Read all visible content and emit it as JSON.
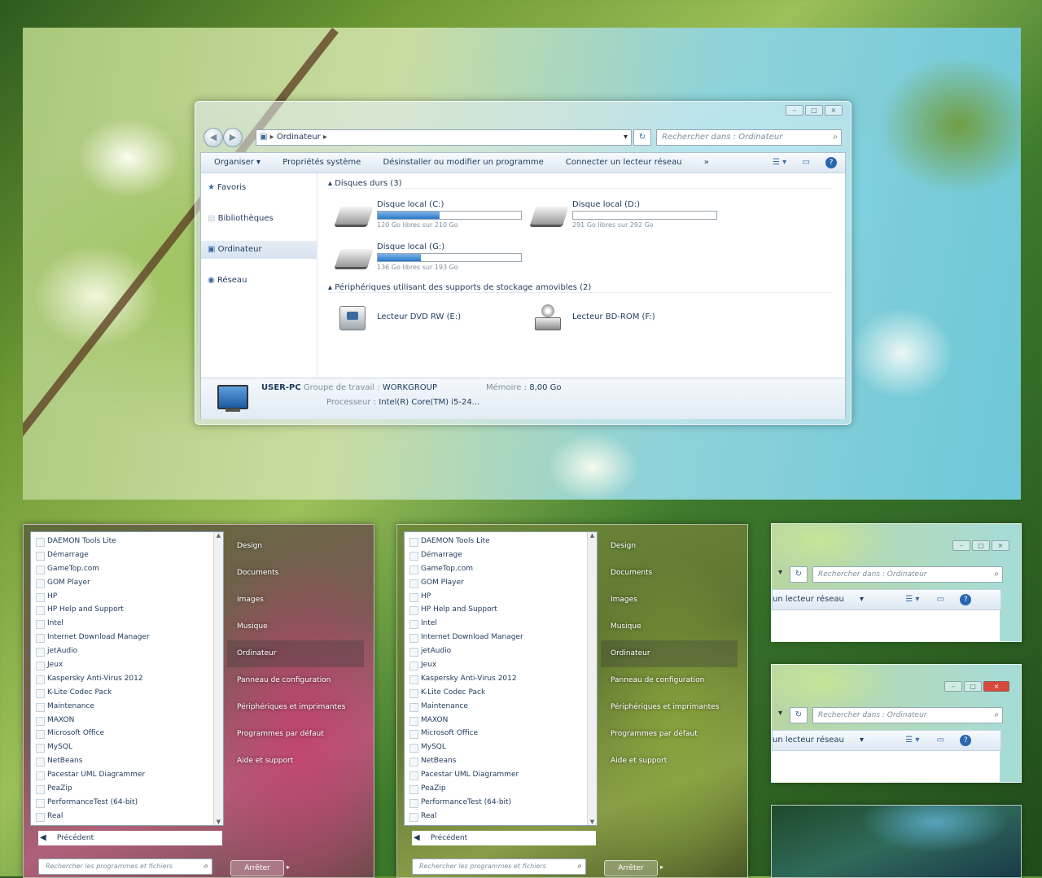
{
  "explorer": {
    "breadcrumb": "Ordinateur",
    "search_placeholder": "Rechercher dans : Ordinateur",
    "toolbar": [
      "Organiser ▾",
      "Propriétés système",
      "Désinstaller ou modifier un programme",
      "Connecter un lecteur réseau",
      "»"
    ],
    "nav": [
      "Favoris",
      "Bibliothèques",
      "Ordinateur",
      "Réseau"
    ],
    "hard_drives_header": "Disques durs (3)",
    "drives": [
      {
        "name": "Disque local (C:)",
        "free": "120 Go libres sur 210 Go",
        "used_fraction": 0.43
      },
      {
        "name": "Disque local (D:)",
        "free": "291 Go libres sur 292 Go",
        "used_fraction": 0.0
      },
      {
        "name": "Disque local (G:)",
        "free": "136 Go libres sur 193 Go",
        "used_fraction": 0.3
      }
    ],
    "removable_header": "Périphériques utilisant des supports de stockage amovibles (2)",
    "removable": [
      {
        "name": "Lecteur DVD RW (E:)"
      },
      {
        "name": "Lecteur BD-ROM (F:)"
      }
    ],
    "details": {
      "pc_name": "USER-PC",
      "workgroup_label": "Groupe de travail :",
      "workgroup": "WORKGROUP",
      "memory_label": "Mémoire :",
      "memory": "8,00 Go",
      "processor_label": "Processeur :",
      "processor": "Intel(R) Core(TM) i5-24..."
    }
  },
  "start_menu": {
    "programs": [
      "DAEMON Tools Lite",
      "Démarrage",
      "GameTop.com",
      "GOM Player",
      "HP",
      "HP Help and Support",
      "Intel",
      "Internet Download Manager",
      "jetAudio",
      "Jeux",
      "Kaspersky Anti-Virus 2012",
      "K-Lite Codec Pack",
      "Maintenance",
      "MAXON",
      "Microsoft Office",
      "MySQL",
      "NetBeans",
      "Pacestar UML Diagrammer",
      "PeaZip",
      "PerformanceTest (64-bit)",
      "Real"
    ],
    "back": "Précédent",
    "search_placeholder": "Rechercher les programmes et fichiers",
    "places": [
      "Design",
      "Documents",
      "Images",
      "Musique",
      "Ordinateur",
      "Panneau de configuration",
      "Périphériques et imprimantes",
      "Programmes par défaut",
      "Aide et support"
    ],
    "shutdown": "Arrêter"
  },
  "thumbs": {
    "search_placeholder": "Rechercher dans : Ordinateur",
    "toolbar_text": "un lecteur réseau"
  }
}
